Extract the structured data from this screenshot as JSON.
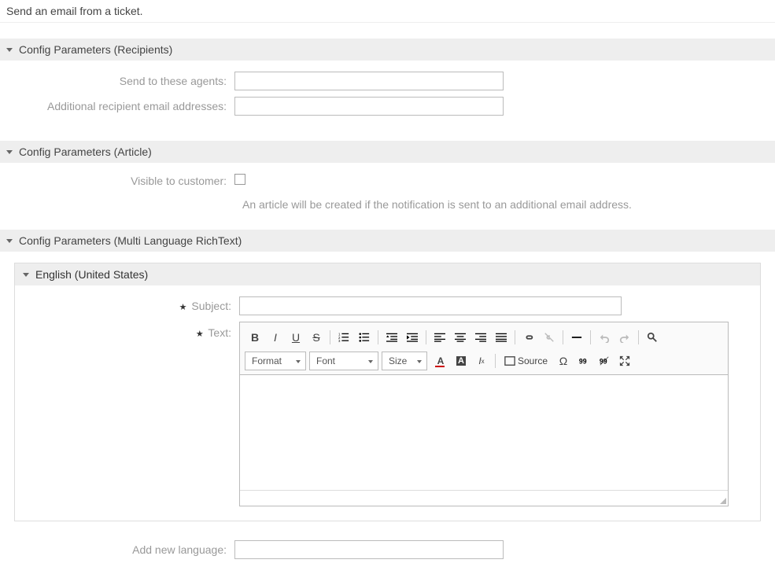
{
  "description": "Send an email from a ticket.",
  "sections": {
    "recipients": {
      "title": "Config Parameters (Recipients)",
      "sendToLabel": "Send to these agents:",
      "additionalLabel": "Additional recipient email addresses:"
    },
    "article": {
      "title": "Config Parameters (Article)",
      "visibleLabel": "Visible to customer:",
      "note": "An article will be created if the notification is sent to an additional email address."
    },
    "richtext": {
      "title": "Config Parameters (Multi Language RichText)",
      "language": "English (United States)",
      "subjectLabel": "Subject:",
      "textLabel": "Text:",
      "addLangLabel": "Add new language:",
      "toolbar": {
        "format": "Format",
        "font": "Font",
        "size": "Size",
        "source": "Source"
      }
    }
  }
}
